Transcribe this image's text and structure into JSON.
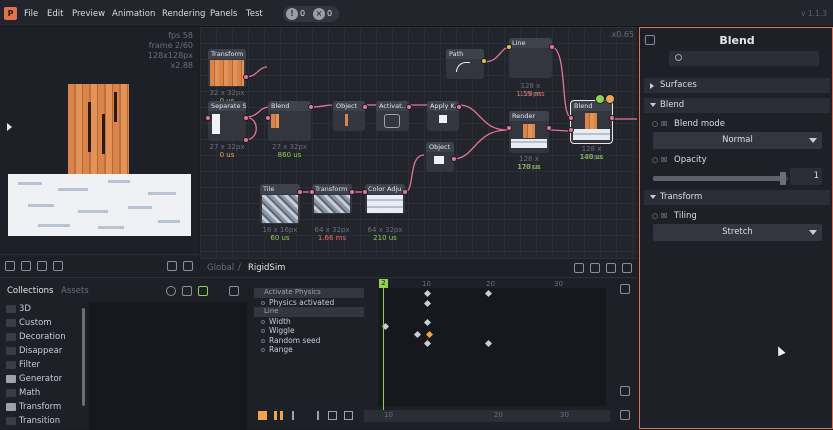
{
  "menu": [
    "File",
    "Edit",
    "Preview",
    "Animation",
    "Rendering",
    "Panels",
    "Test"
  ],
  "status": {
    "warnings": "0",
    "errors": "0"
  },
  "version": "v 1.1.3",
  "preview": {
    "fps": "fps 58",
    "frame": "frame 2/60",
    "size": "128x128px",
    "zoom": "x2.88"
  },
  "graph": {
    "zoom": "x0.65",
    "nodes": [
      {
        "id": "transform1",
        "title": "Transform",
        "size": "32 x 32px",
        "time": "0 us"
      },
      {
        "id": "separate",
        "title": "Separate S",
        "size": "27 x 32px",
        "time": "0 us"
      },
      {
        "id": "blend1",
        "title": "Blend",
        "size": "27 x 32px",
        "time": "860 us"
      },
      {
        "id": "object1",
        "title": "Object",
        "size": "",
        "time": ""
      },
      {
        "id": "activate",
        "title": "Activat...",
        "size": "",
        "time": ""
      },
      {
        "id": "applyk",
        "title": "Apply K...",
        "size": "",
        "time": ""
      },
      {
        "id": "path",
        "title": "Path",
        "size": "",
        "time": ""
      },
      {
        "id": "line",
        "title": "Line",
        "size": "128 x 128px",
        "time": "1.59 ms"
      },
      {
        "id": "render",
        "title": "Render",
        "size": "128 x 128px",
        "time": "170 us"
      },
      {
        "id": "blend2",
        "title": "Blend",
        "size": "128 x 128px",
        "time": "140 us"
      },
      {
        "id": "object2",
        "title": "Object",
        "size": "",
        "time": ""
      },
      {
        "id": "tile",
        "title": "Tile",
        "size": "16 x 16px",
        "time": "60 us"
      },
      {
        "id": "transform2",
        "title": "Transform",
        "size": "64 x 32px",
        "time": "1.66 ms"
      },
      {
        "id": "coloradj",
        "title": "Color Adju...",
        "size": "64 x 32px",
        "time": "210 us"
      }
    ]
  },
  "graph_footer": {
    "global": "Global",
    "sep": "/",
    "current": "RigidSim"
  },
  "collections": {
    "tab_collections": "Collections",
    "tab_assets": "Assets",
    "items": [
      "3D",
      "Custom",
      "Decoration",
      "Disappear",
      "Filter",
      "Generator",
      "Math",
      "Transform",
      "Transition"
    ]
  },
  "timeline": {
    "ruler": [
      "10",
      "20",
      "30"
    ],
    "bottom_ruler": [
      "10",
      "20",
      "30"
    ],
    "playhead": "2",
    "rows": [
      {
        "label": "Activate Physics",
        "header": true
      },
      {
        "label": "Physics activated",
        "header": false
      },
      {
        "label": "Line",
        "header": true
      },
      {
        "label": "Width",
        "header": false
      },
      {
        "label": "Wiggle",
        "header": false
      },
      {
        "label": "Random seed",
        "header": false
      },
      {
        "label": "Range",
        "header": false
      }
    ]
  },
  "properties": {
    "title": "Blend",
    "sections": {
      "surfaces": "Surfaces",
      "blend": "Blend",
      "transform": "Transform"
    },
    "blend_mode_label": "Blend mode",
    "blend_mode_value": "Normal",
    "opacity_label": "Opacity",
    "opacity_value": "1",
    "opacity_fraction": 0.96,
    "tiling_label": "Tiling",
    "tiling_value": "Stretch"
  },
  "colors": {
    "accent": "#d9735a",
    "success": "#8fd14f",
    "pin": "#e4739a"
  }
}
